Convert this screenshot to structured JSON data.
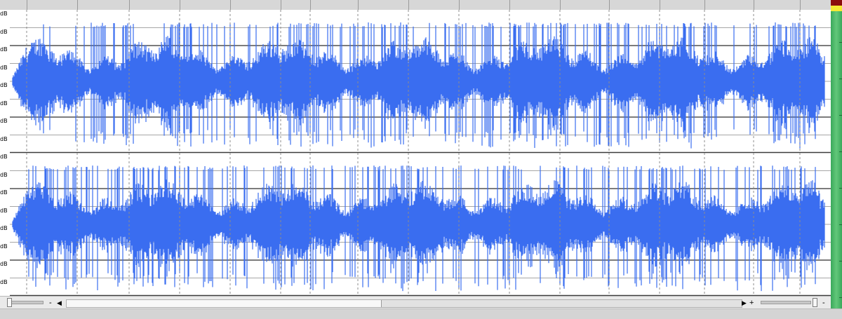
{
  "app": {
    "accent_color": "#3a6df0",
    "background": "#ffffff"
  },
  "waveform": {
    "channels": [
      {
        "name": "",
        "db_labels": [
          "dB",
          "dB",
          "dB",
          "dB",
          "dB",
          "dB",
          "dB",
          "dB"
        ]
      },
      {
        "name": "",
        "db_labels": [
          "dB",
          "dB",
          "dB",
          "dB",
          "dB",
          "dB",
          "dB",
          "dB"
        ]
      }
    ],
    "colors": {
      "wave": "#3a6df0",
      "grid_major": "#505050",
      "grid_minor": "#a6a6a6",
      "marker": "#8c8c8c"
    }
  },
  "controls": {
    "zoom_out_label": "-",
    "scroll_left_icon": "triangle-left",
    "scroll_right_icon": "triangle-right",
    "zoom_in_label": "+",
    "zoom_right_out_label": "-"
  },
  "meter": {
    "level_colors": {
      "peak": "#8b0c0c",
      "warn": "#f4ea34",
      "ok": "#3aa95b"
    }
  }
}
